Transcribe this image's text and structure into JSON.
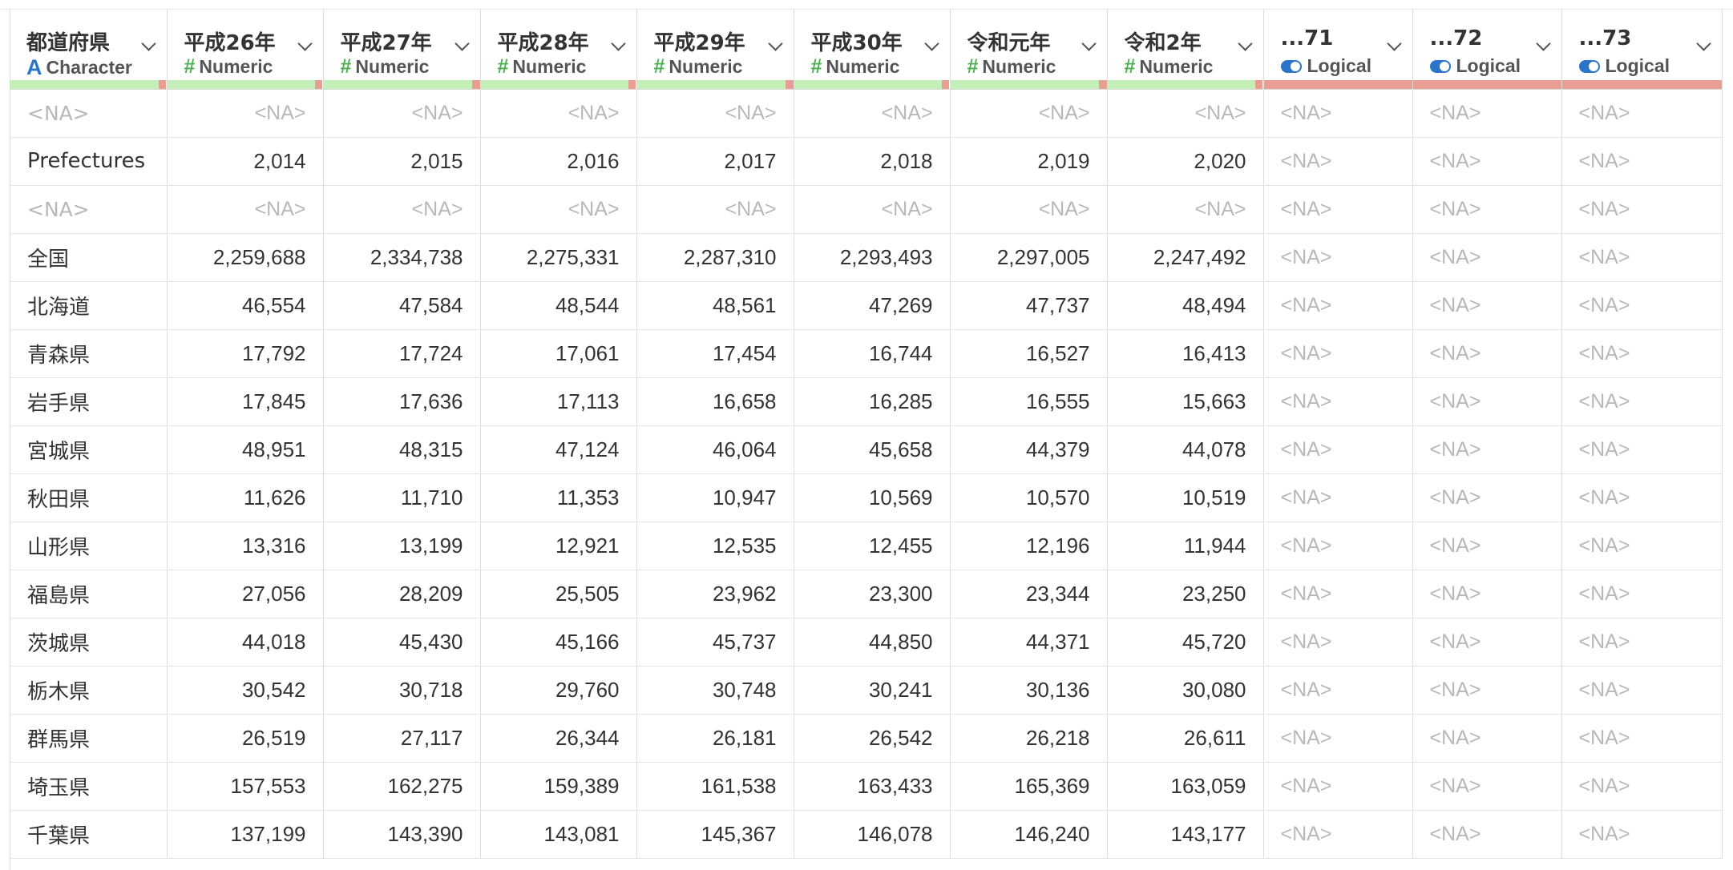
{
  "na_text": "<NA>",
  "columns": [
    {
      "name": "都道府県",
      "type": "Character",
      "icon": "character-type-icon",
      "kind": "char",
      "width": 196,
      "na_fraction": 0.05
    },
    {
      "name": "平成26年",
      "type": "Numeric",
      "icon": "numeric-type-icon",
      "kind": "num",
      "width": 195,
      "na_fraction": 0.05
    },
    {
      "name": "平成27年",
      "type": "Numeric",
      "icon": "numeric-type-icon",
      "kind": "num",
      "width": 196,
      "na_fraction": 0.05
    },
    {
      "name": "平成28年",
      "type": "Numeric",
      "icon": "numeric-type-icon",
      "kind": "num",
      "width": 195,
      "na_fraction": 0.05
    },
    {
      "name": "平成29年",
      "type": "Numeric",
      "icon": "numeric-type-icon",
      "kind": "num",
      "width": 196,
      "na_fraction": 0.05
    },
    {
      "name": "平成30年",
      "type": "Numeric",
      "icon": "numeric-type-icon",
      "kind": "num",
      "width": 195,
      "na_fraction": 0.05
    },
    {
      "name": "令和元年",
      "type": "Numeric",
      "icon": "numeric-type-icon",
      "kind": "num",
      "width": 196,
      "na_fraction": 0.05
    },
    {
      "name": "令和2年",
      "type": "Numeric",
      "icon": "numeric-type-icon",
      "kind": "num",
      "width": 195,
      "na_fraction": 0.05
    },
    {
      "name": "...71",
      "type": "Logical",
      "icon": "logical-type-icon",
      "kind": "logi",
      "width": 186,
      "na_fraction": 1
    },
    {
      "name": "...72",
      "type": "Logical",
      "icon": "logical-type-icon",
      "kind": "logi",
      "width": 186,
      "na_fraction": 1
    },
    {
      "name": "...73",
      "type": "Logical",
      "icon": "logical-type-icon",
      "kind": "logi",
      "width": 200,
      "na_fraction": 1
    }
  ],
  "rows": [
    [
      null,
      null,
      null,
      null,
      null,
      null,
      null,
      null
    ],
    [
      "Prefectures",
      "2,014",
      "2,015",
      "2,016",
      "2,017",
      "2,018",
      "2,019",
      "2,020"
    ],
    [
      null,
      null,
      null,
      null,
      null,
      null,
      null,
      null
    ],
    [
      "全国",
      "2,259,688",
      "2,334,738",
      "2,275,331",
      "2,287,310",
      "2,293,493",
      "2,297,005",
      "2,247,492"
    ],
    [
      "北海道",
      "46,554",
      "47,584",
      "48,544",
      "48,561",
      "47,269",
      "47,737",
      "48,494"
    ],
    [
      "青森県",
      "17,792",
      "17,724",
      "17,061",
      "17,454",
      "16,744",
      "16,527",
      "16,413"
    ],
    [
      "岩手県",
      "17,845",
      "17,636",
      "17,113",
      "16,658",
      "16,285",
      "16,555",
      "15,663"
    ],
    [
      "宮城県",
      "48,951",
      "48,315",
      "47,124",
      "46,064",
      "45,658",
      "44,379",
      "44,078"
    ],
    [
      "秋田県",
      "11,626",
      "11,710",
      "11,353",
      "10,947",
      "10,569",
      "10,570",
      "10,519"
    ],
    [
      "山形県",
      "13,316",
      "13,199",
      "12,921",
      "12,535",
      "12,455",
      "12,196",
      "11,944"
    ],
    [
      "福島県",
      "27,056",
      "28,209",
      "25,505",
      "23,962",
      "23,300",
      "23,344",
      "23,250"
    ],
    [
      "茨城県",
      "44,018",
      "45,430",
      "45,166",
      "45,737",
      "44,850",
      "44,371",
      "45,720"
    ],
    [
      "栃木県",
      "30,542",
      "30,718",
      "29,760",
      "30,748",
      "30,241",
      "30,136",
      "30,080"
    ],
    [
      "群馬県",
      "26,519",
      "27,117",
      "26,344",
      "26,181",
      "26,542",
      "26,218",
      "26,611"
    ],
    [
      "埼玉県",
      "157,553",
      "162,275",
      "159,389",
      "161,538",
      "163,433",
      "165,369",
      "163,059"
    ],
    [
      "千葉県",
      "137,199",
      "143,390",
      "143,081",
      "145,367",
      "146,078",
      "146,240",
      "143,177"
    ]
  ]
}
